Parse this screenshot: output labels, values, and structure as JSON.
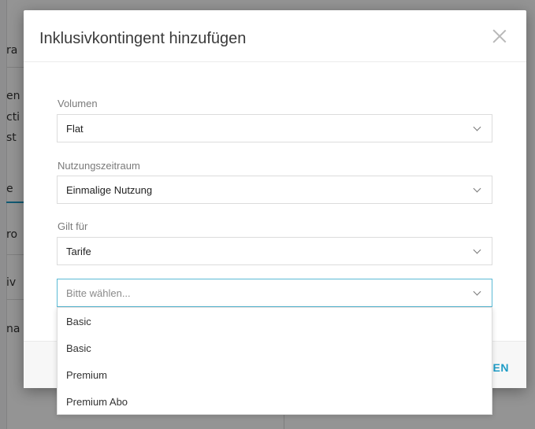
{
  "background": {
    "fragments": [
      "ra",
      "en",
      "cti",
      "st",
      "e",
      "ro",
      "iv",
      "na"
    ]
  },
  "modal": {
    "title": "Inklusivkontingent hinzufügen",
    "fields": [
      {
        "label": "Volumen",
        "value": "Flat"
      },
      {
        "label": "Nutzungszeitraum",
        "value": "Einmalige Nutzung"
      },
      {
        "label": "Gilt für",
        "value": "Tarife"
      }
    ],
    "open_select": {
      "placeholder": "Bitte wählen..."
    },
    "footer_button_fragment": "EN"
  },
  "dropdown": {
    "options": [
      "Basic",
      "Basic",
      "Premium",
      "Premium Abo"
    ]
  },
  "colors": {
    "accent": "#1e9cc6",
    "focus_border": "#5bbad5"
  }
}
